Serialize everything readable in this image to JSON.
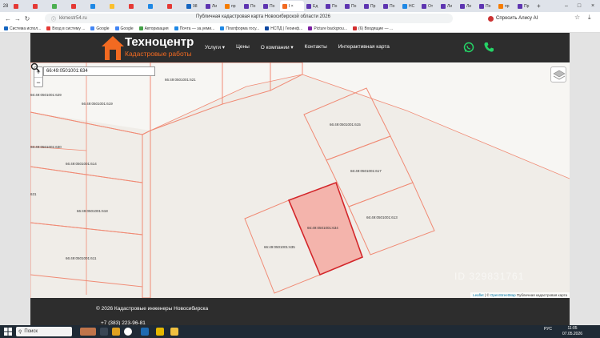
{
  "browser": {
    "tab_count": "28",
    "tabs": [
      {
        "label": "",
        "color": "#e53935"
      },
      {
        "label": "",
        "color": "#e53935"
      },
      {
        "label": "",
        "color": "#4caf50"
      },
      {
        "label": "",
        "color": "#e53935"
      },
      {
        "label": "",
        "color": "#1e88e5"
      },
      {
        "label": "",
        "color": "#fbc02d"
      },
      {
        "label": "",
        "color": "#e53935"
      },
      {
        "label": "",
        "color": "#1e88e5"
      },
      {
        "label": "",
        "color": "#e53935"
      },
      {
        "label": "98",
        "color": "#1565c0"
      },
      {
        "label": "Ли",
        "color": "#5e35b1"
      },
      {
        "label": "пр",
        "color": "#f57c00"
      },
      {
        "label": "По",
        "color": "#5e35b1"
      },
      {
        "label": "По",
        "color": "#5e35b1"
      },
      {
        "label": "I ×",
        "color": "#f26a21",
        "active": true
      },
      {
        "label": "Ед",
        "color": "#5e35b1"
      },
      {
        "label": "По",
        "color": "#5e35b1"
      },
      {
        "label": "По",
        "color": "#5e35b1"
      },
      {
        "label": "Пр",
        "color": "#5e35b1"
      },
      {
        "label": "По",
        "color": "#5e35b1"
      },
      {
        "label": "НС",
        "color": "#1e88e5"
      },
      {
        "label": "От",
        "color": "#5e35b1"
      },
      {
        "label": "Ли",
        "color": "#5e35b1"
      },
      {
        "label": "Ли",
        "color": "#5e35b1"
      },
      {
        "label": "По",
        "color": "#5e35b1"
      },
      {
        "label": "пр",
        "color": "#f57c00"
      },
      {
        "label": "Пр",
        "color": "#5e35b1"
      }
    ],
    "new_tab": "+",
    "window_controls": [
      "–",
      "□",
      "×"
    ],
    "url": "kkmestr54.ru",
    "page_title": "Публичная кадастровая карта Новосибирской области 2026",
    "alice_label": "Спросить Алису AI",
    "bookmarks": [
      "Система испол...",
      "Вход в систему ...",
      "Google",
      "Google",
      "Авторизация",
      "Почта — за.уеми...",
      "Платформа госу...",
      "НСПД | Геоинф...",
      "Picture backgrou...",
      "(6) Входящие — ..."
    ]
  },
  "site": {
    "logo_title": "Техноцентр",
    "logo_subtitle": "Кадастровые работы",
    "nav": [
      "Услуги ▾",
      "Цены",
      "О компании ▾",
      "Контакты",
      "Интерактивная карта"
    ],
    "footer_copyright": "© 2026 Кадастровые инженеры Новосибирска",
    "footer_phone": "+7 (383) 223-96-81"
  },
  "map": {
    "zoom_in": "+",
    "zoom_out": "−",
    "search_value": "66:49:0501001:634",
    "parcels": {
      "p621": "66:49:0501001:621",
      "p619": "66:49:0501001:619",
      "p629": "66:49:0501001:629",
      "p630": "66:49:0501001:630",
      "p614": "66:49:0501001:614",
      "p631": "631",
      "p618": "66:49:0501001:618",
      "p611": "66:49:0501001:611",
      "p615": "66:49:0501001:615",
      "p617": "66:49:0501001:617",
      "p613": "66:49:0501001:613",
      "p634": "66:49:0501001:634",
      "p635": "66:49:0501001:635"
    },
    "attribution_leaflet": "Leaflet",
    "attribution_sep": " | © ",
    "attribution_osm": "OpenStreetMap",
    "attribution_rest": " Публичная кадастровая карта",
    "selected_fill": "#f4b4ac",
    "selected_stroke": "#d3262a",
    "boundary_color": "#f08a74"
  },
  "watermark": "ID 329831761",
  "taskbar": {
    "search_label": "Поиск",
    "tray_lang": "РУС",
    "clock_time": "11:05",
    "clock_date": "07.05.2026"
  }
}
